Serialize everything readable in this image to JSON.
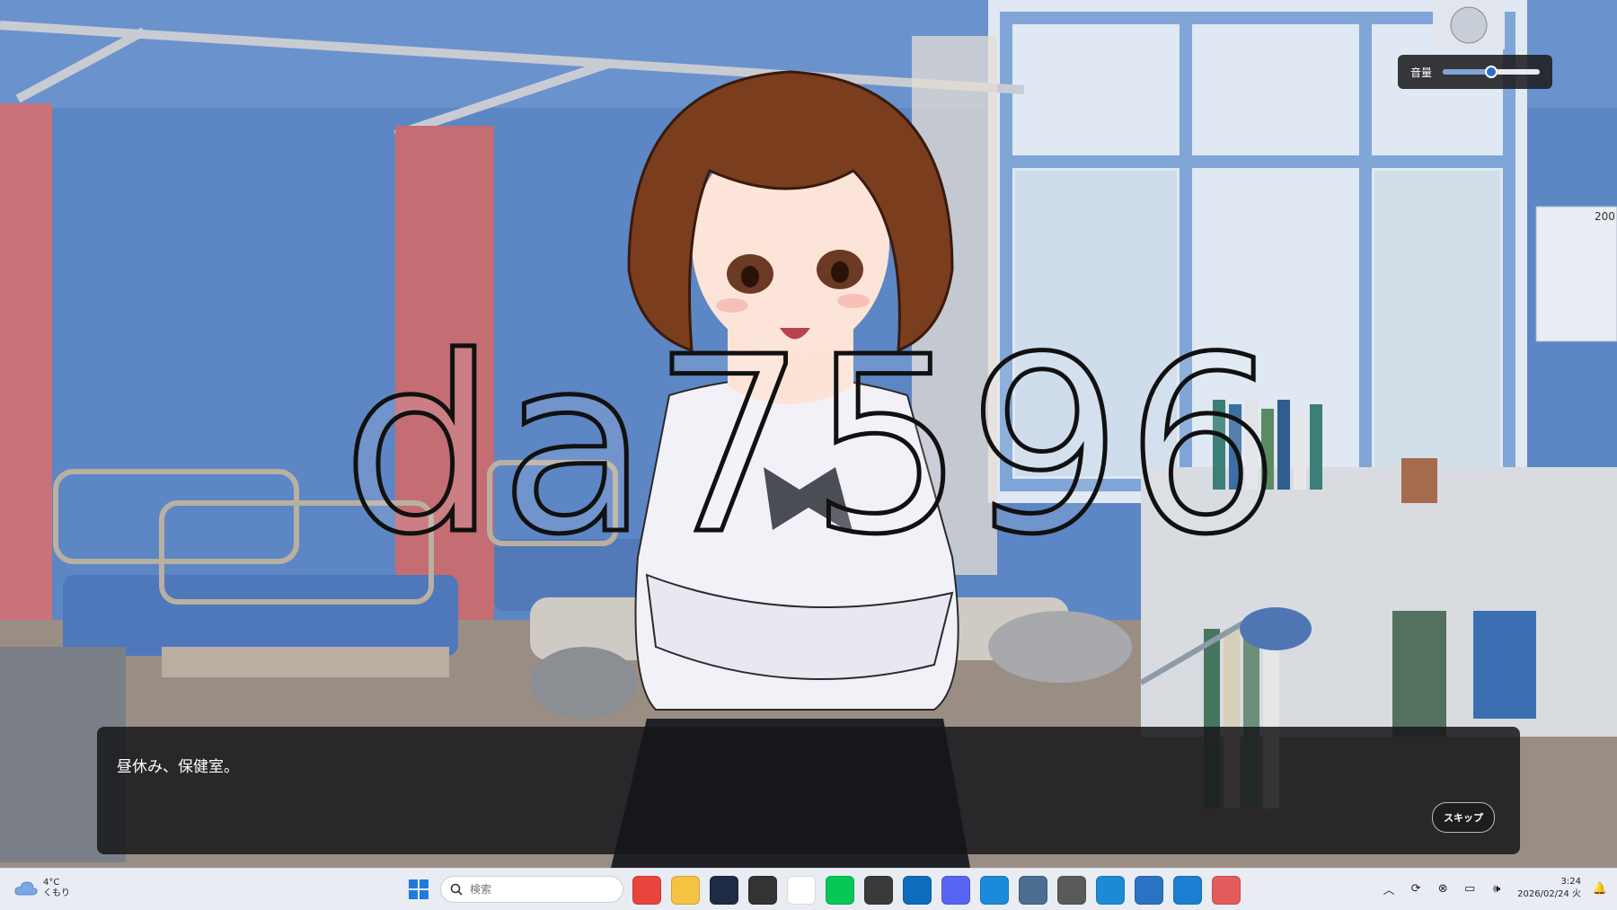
{
  "game": {
    "volume": {
      "label": "音量",
      "level": 0.5
    },
    "watermark": "da7596",
    "dialogue": {
      "text": "昼休み、保健室。"
    },
    "skip_label": "スキップ",
    "poster_text": "200"
  },
  "taskbar": {
    "weather": {
      "temp": "4°C",
      "condition": "くもり"
    },
    "search_placeholder": "検索",
    "apps": [
      {
        "name": "chrome-icon",
        "color": "#e8453c"
      },
      {
        "name": "file-explorer-icon",
        "color": "#f5c242"
      },
      {
        "name": "kindle-icon",
        "color": "#1f2a44"
      },
      {
        "name": "chatgpt-icon",
        "color": "#333333"
      },
      {
        "name": "notion-icon",
        "color": "#ffffff"
      },
      {
        "name": "line-icon",
        "color": "#06c755"
      },
      {
        "name": "assistant-icon",
        "color": "#3a3a3a"
      },
      {
        "name": "outlook-icon",
        "color": "#0f6cbd"
      },
      {
        "name": "discord-icon",
        "color": "#5865f2"
      },
      {
        "name": "edge-icon",
        "color": "#1c8adb"
      },
      {
        "name": "notepad-icon",
        "color": "#4b6d8f"
      },
      {
        "name": "clipchamp-icon",
        "color": "#5a5a5a"
      },
      {
        "name": "vscode-icon",
        "color": "#1e8ad6"
      },
      {
        "name": "window-app-icon",
        "color": "#2a72c4"
      },
      {
        "name": "terminal-icon",
        "color": "#1a7fd1"
      },
      {
        "name": "paint-icon",
        "color": "#e45b5b"
      }
    ],
    "tray": [
      {
        "name": "chevron-up-icon",
        "glyph": "︿"
      },
      {
        "name": "sync-icon",
        "glyph": "⟳"
      },
      {
        "name": "close-circle-icon",
        "glyph": "⊗"
      },
      {
        "name": "display-icon",
        "glyph": "▭"
      },
      {
        "name": "speaker-icon",
        "glyph": "🕪"
      }
    ],
    "time": "3:24",
    "date": "2026/02/24 火",
    "notification_glyph": "🔔"
  },
  "colors": {
    "wall": "#5f86c2",
    "curtain": "#c96f75",
    "dialogue_bg": "#16161a",
    "accent": "#2f6ecb"
  }
}
